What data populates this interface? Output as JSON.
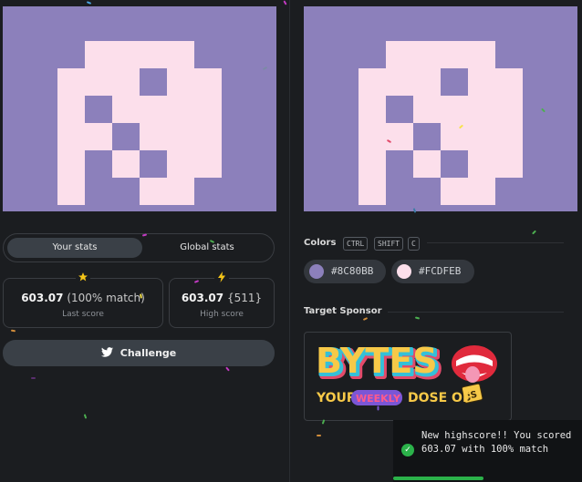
{
  "colors": {
    "background": "#8C80BB",
    "foreground": "#FCDFEB",
    "accent_success": "#2BB24A",
    "tab_active": "#3A4047"
  },
  "canvas_pattern": {
    "rows": [
      "..........",
      "...####...",
      "..###.##..",
      "..#.####..",
      "..##.###..",
      "..#.#.##..",
      "..#..##...",
      ".........."
    ]
  },
  "stats_tabs": {
    "your_stats": "Your stats",
    "global_stats": "Global stats"
  },
  "last_score": {
    "icon": "star-icon",
    "value": "603.07",
    "match": "(100% match)",
    "label": "Last score"
  },
  "high_score": {
    "icon": "lightning-icon",
    "value": "603.07",
    "rank": "{511}",
    "label": "High score"
  },
  "challenge_button": {
    "icon": "twitter-icon",
    "label": "Challenge"
  },
  "colors_section": {
    "title": "Colors",
    "keys": [
      "CTRL",
      "SHIFT",
      "C"
    ],
    "chips": [
      {
        "hex": "#8C80BB"
      },
      {
        "hex": "#FCDFEB"
      }
    ]
  },
  "sponsor": {
    "title": "Target Sponsor",
    "brand": "BYTES",
    "tagline_left": "YOUR",
    "tagline_pill": "WEEKLY",
    "tagline_right": "DOSE OF",
    "badge": "JS"
  },
  "toast": {
    "icon": "check-circle-icon",
    "message": "New highscore!! You scored 603.07 with 100% match",
    "progress": 0.48
  }
}
